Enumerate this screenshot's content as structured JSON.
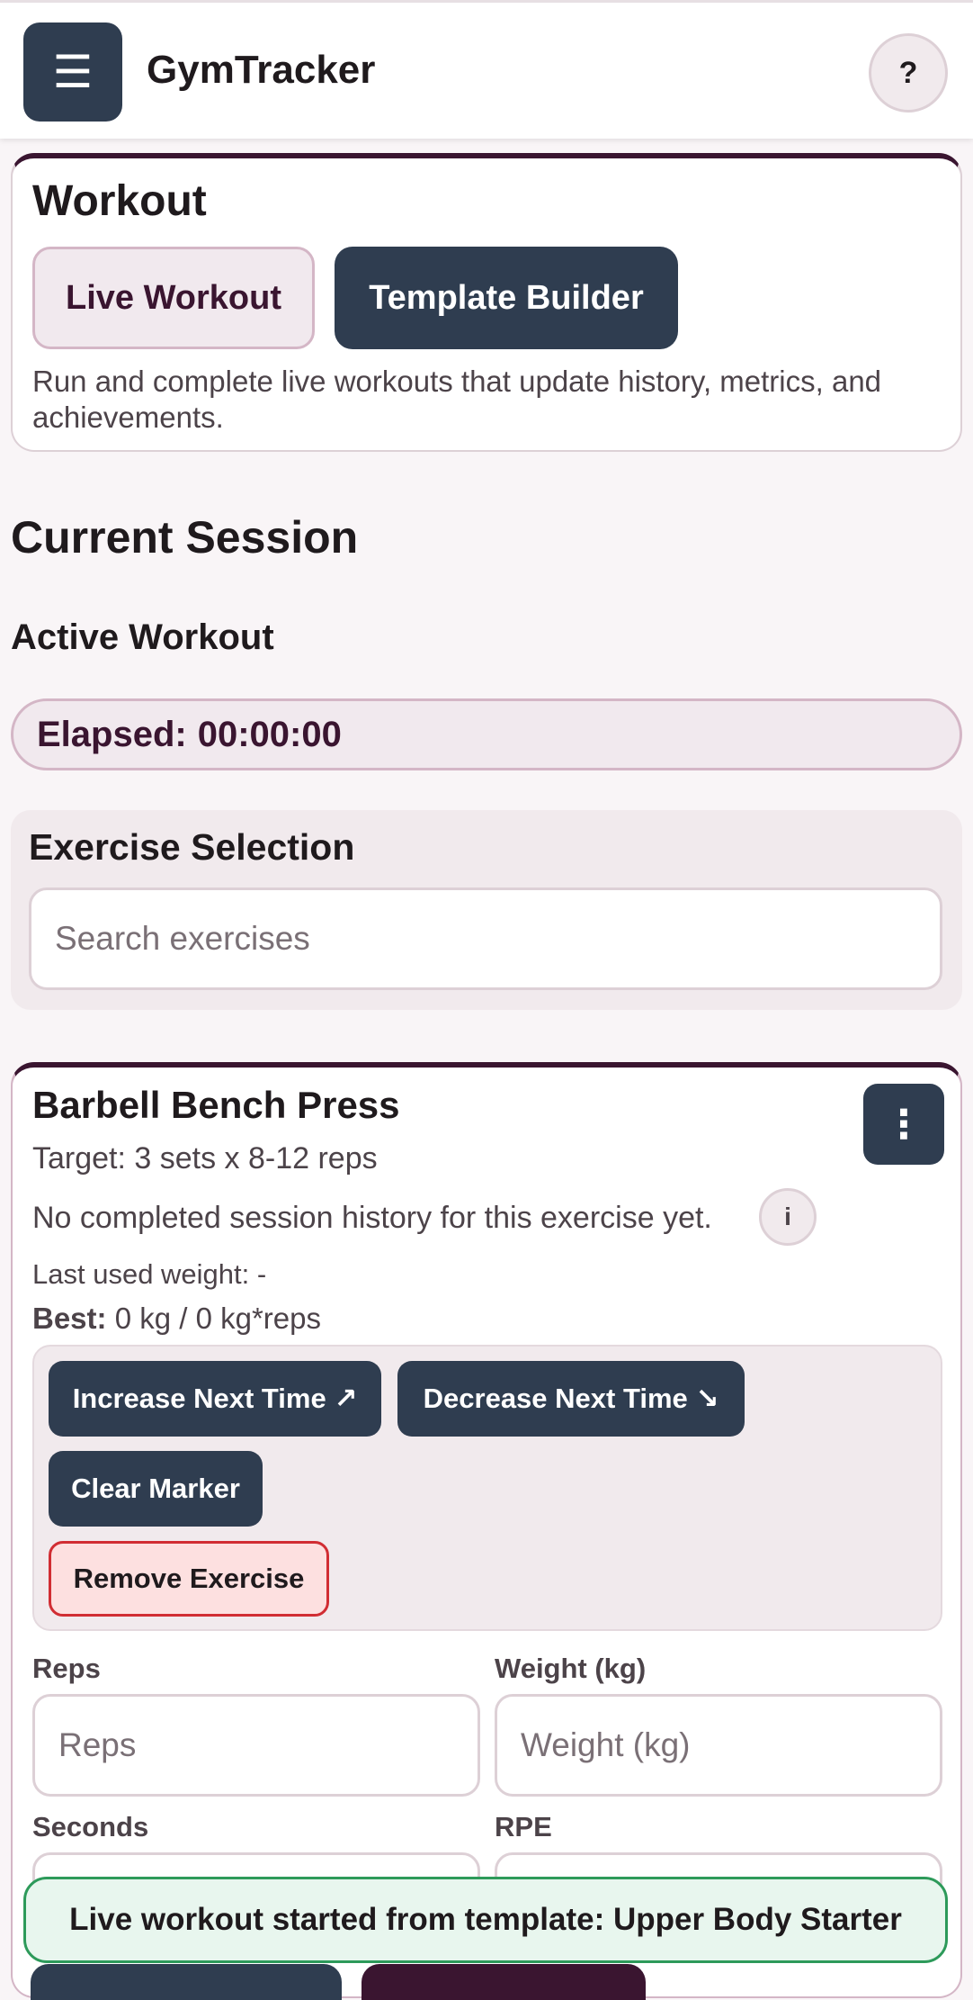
{
  "header": {
    "menu_icon": "☰",
    "title": "GymTracker",
    "help_label": "?"
  },
  "workout": {
    "title": "Workout",
    "tabs": [
      {
        "label": "Live Workout",
        "selected": true
      },
      {
        "label": "Template Builder",
        "selected": false
      }
    ],
    "description": "Run and complete live workouts that update history, metrics, and achievements."
  },
  "session": {
    "heading": "Current Session",
    "active_heading": "Active Workout",
    "elapsed_label": "Elapsed:",
    "elapsed_value": "00:00:00"
  },
  "exercise_selection": {
    "title": "Exercise Selection",
    "search_placeholder": "Search exercises"
  },
  "exercise": {
    "name": "Barbell Bench Press",
    "menu_icon": "⋮",
    "target": "Target: 3 sets x 8-12 reps",
    "history_note": "No completed session history for this exercise yet.",
    "info_label": "i",
    "last_used": "Last used weight: -",
    "best_label": "Best:",
    "best_value": "0 kg / 0 kg*reps",
    "actions": {
      "increase": "Increase Next Time ↗",
      "decrease": "Decrease Next Time ↘",
      "clear": "Clear Marker",
      "remove": "Remove Exercise"
    },
    "fields": {
      "reps_label": "Reps",
      "reps_placeholder": "Reps",
      "weight_label": "Weight (kg)",
      "weight_placeholder": "Weight (kg)",
      "seconds_label": "Seconds",
      "rpe_label": "RPE"
    }
  },
  "toast": {
    "message": "Live workout started from template: Upper Body Starter"
  },
  "colors": {
    "primary_dark": "#2f3d50",
    "accent_plum": "#3a1530",
    "danger": "#d12d33",
    "success": "#2d9a5a",
    "background": "#f9f5f7"
  }
}
